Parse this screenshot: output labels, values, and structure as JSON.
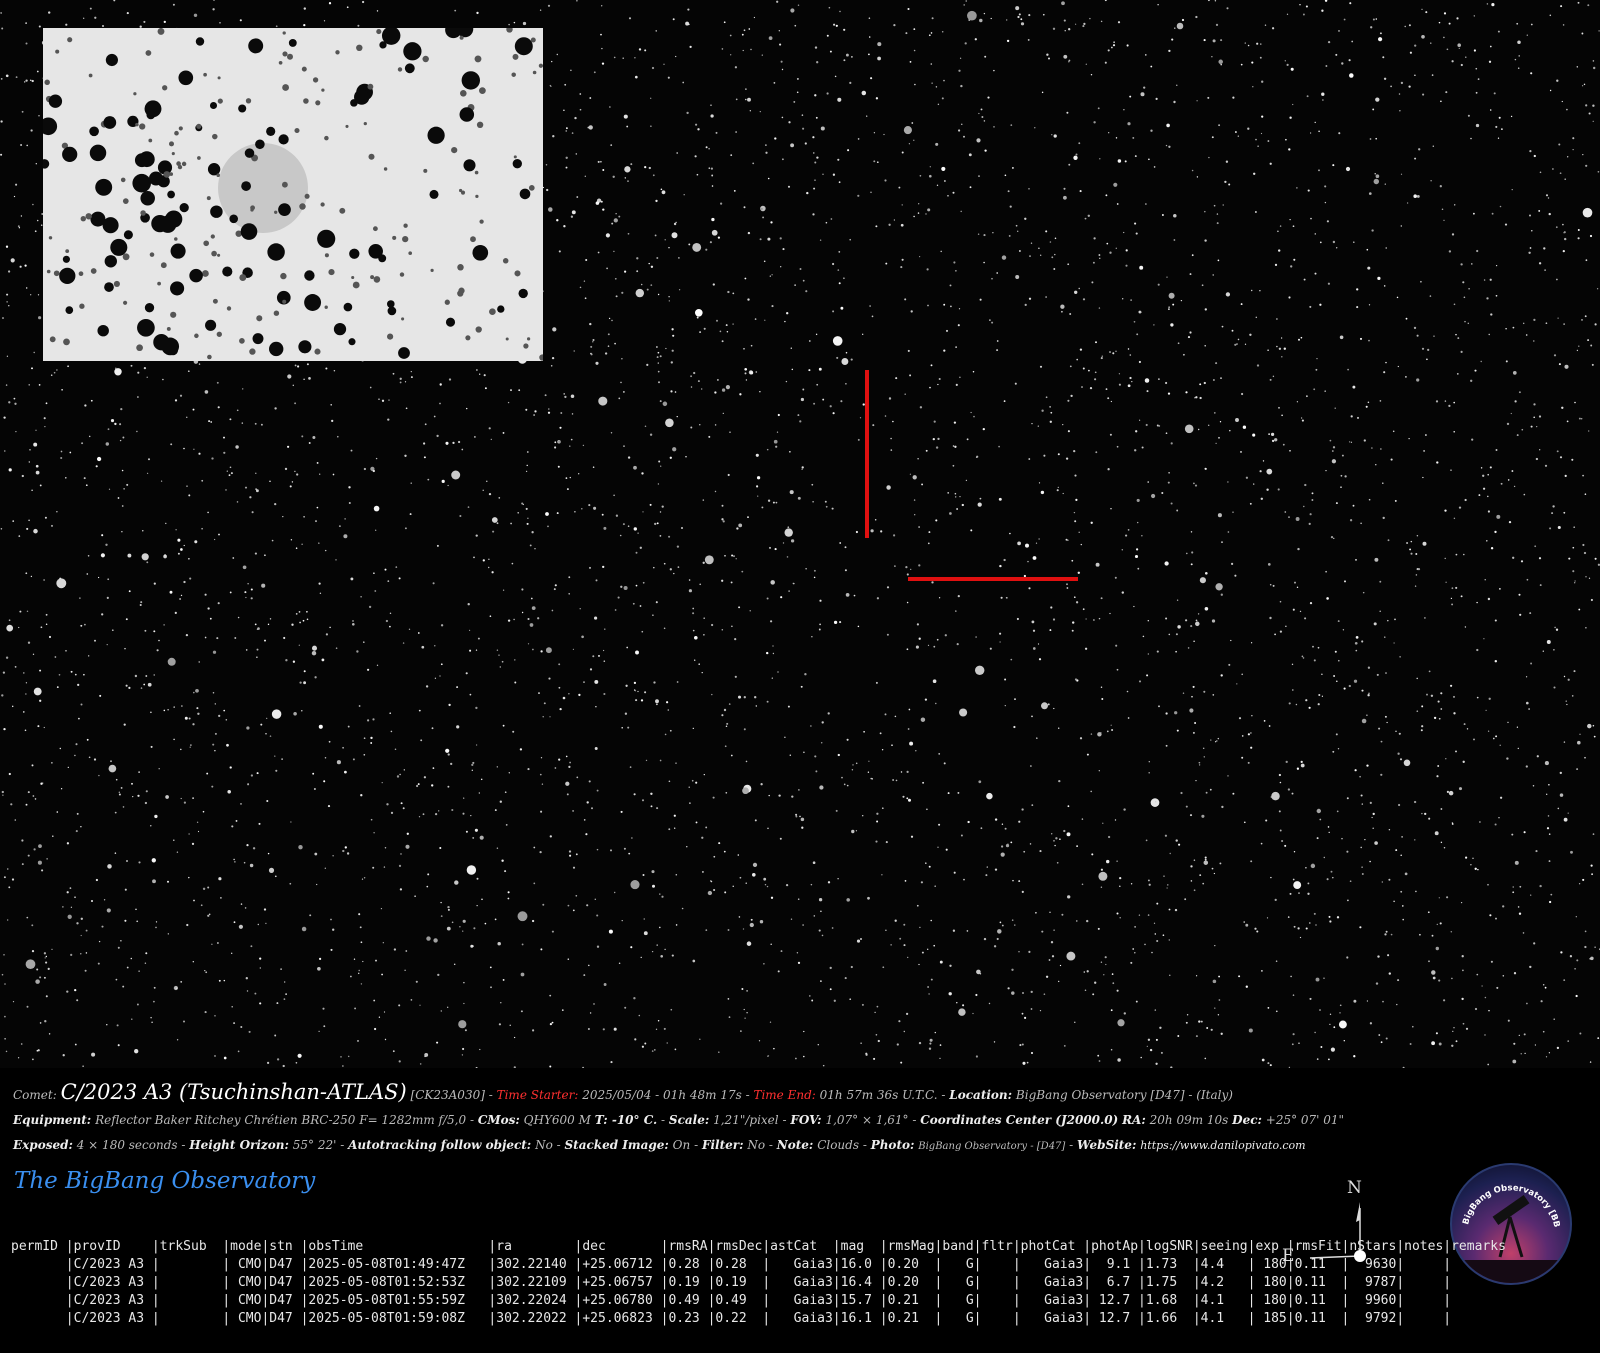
{
  "caption": {
    "comet_label": "Comet:",
    "comet_name": "C/2023 A3 (Tsuchinshan-ATLAS)",
    "comet_code": "[CK23A030]",
    "time_starter_label": "Time Starter:",
    "time_starter_value": "2025/05/04  -  01h 48m 17s",
    "time_end_label": "Time End:",
    "time_end_value": "01h  57m 36s  U.T.C.",
    "location_label": "Location:",
    "location_value": "BigBang Observatory  [D47] - (Italy)",
    "equipment_label": "Equipment:",
    "equipment_value": "Reflector Baker Ritchey Chrétien BRC-250  F= 1282mm f/5,0",
    "cmos_label": "CMos:",
    "cmos_value": "QHY600 M",
    "temp_value": "T: -10° C.",
    "scale_label": "Scale:",
    "scale_value": "1,21\"/pixel",
    "fov_label": "FOV:",
    "fov_value": "1,07° × 1,61°",
    "coords_label": "Coordinates Center (J2000.0)",
    "ra_label": "RA:",
    "ra_value": "20h 09m 10s",
    "dec_label": "Dec:",
    "dec_value": "+25° 07' 01\"",
    "exposed_label": "Exposed:",
    "exposed_value": "4 × 180 seconds",
    "height_label": "Height Orizon:",
    "height_value": "55° 22'",
    "autotracking_label": "Autotracking follow object:",
    "autotracking_value": "No",
    "stacked_label": "Stacked Image:",
    "stacked_value": "On",
    "filter_label": "Filter:",
    "filter_value": "No",
    "note_label": "Note:",
    "note_value": "Clouds",
    "photo_label": "Photo:",
    "photo_value": "BigBang Observatory - [D47]",
    "website_label": "WebSite:",
    "website_value": "https://www.danilopivato.com"
  },
  "brand": {
    "title": "The BigBang Observatory"
  },
  "logo": {
    "text": "BigBang Observatory [BBO] - D47"
  },
  "compass": {
    "north": "N",
    "east": "E"
  },
  "colors": {
    "marker": "#e01010",
    "brand": "#3a8ff0",
    "highlight_label": "#ff3030"
  },
  "astrometry_table": {
    "header": "permID |provID    |trkSub  |mode|stn |obsTime                |ra        |dec       |rmsRA|rmsDec|astCat  |mag  |rmsMag|band|fltr|photCat |photAp|logSNR|seeing|exp |rmsFit|nStars|notes|remarks",
    "rows": [
      "       |C/2023 A3 |        | CMO|D47 |2025-05-08T01:49:47Z   |302.22140 |+25.06712 |0.28 |0.28  |   Gaia3|16.0 |0.20  |   G|    |   Gaia3|  9.1 |1.73  |4.4   | 180|0.11  |  9630|     |",
      "       |C/2023 A3 |        | CMO|D47 |2025-05-08T01:52:53Z   |302.22109 |+25.06757 |0.19 |0.19  |   Gaia3|16.4 |0.20  |   G|    |   Gaia3|  6.7 |1.75  |4.2   | 180|0.11  |  9787|     |",
      "       |C/2023 A3 |        | CMO|D47 |2025-05-08T01:55:59Z   |302.22024 |+25.06780 |0.49 |0.49  |   Gaia3|15.7 |0.21  |   G|    |   Gaia3| 12.7 |1.68  |4.1   | 180|0.11  |  9960|     |",
      "       |C/2023 A3 |        | CMO|D47 |2025-05-08T01:59:08Z   |302.22022 |+25.06823 |0.23 |0.22  |   Gaia3|16.1 |0.21  |   G|    |   Gaia3| 12.7 |1.66  |4.1   | 185|0.11  |  9792|     |"
    ]
  }
}
